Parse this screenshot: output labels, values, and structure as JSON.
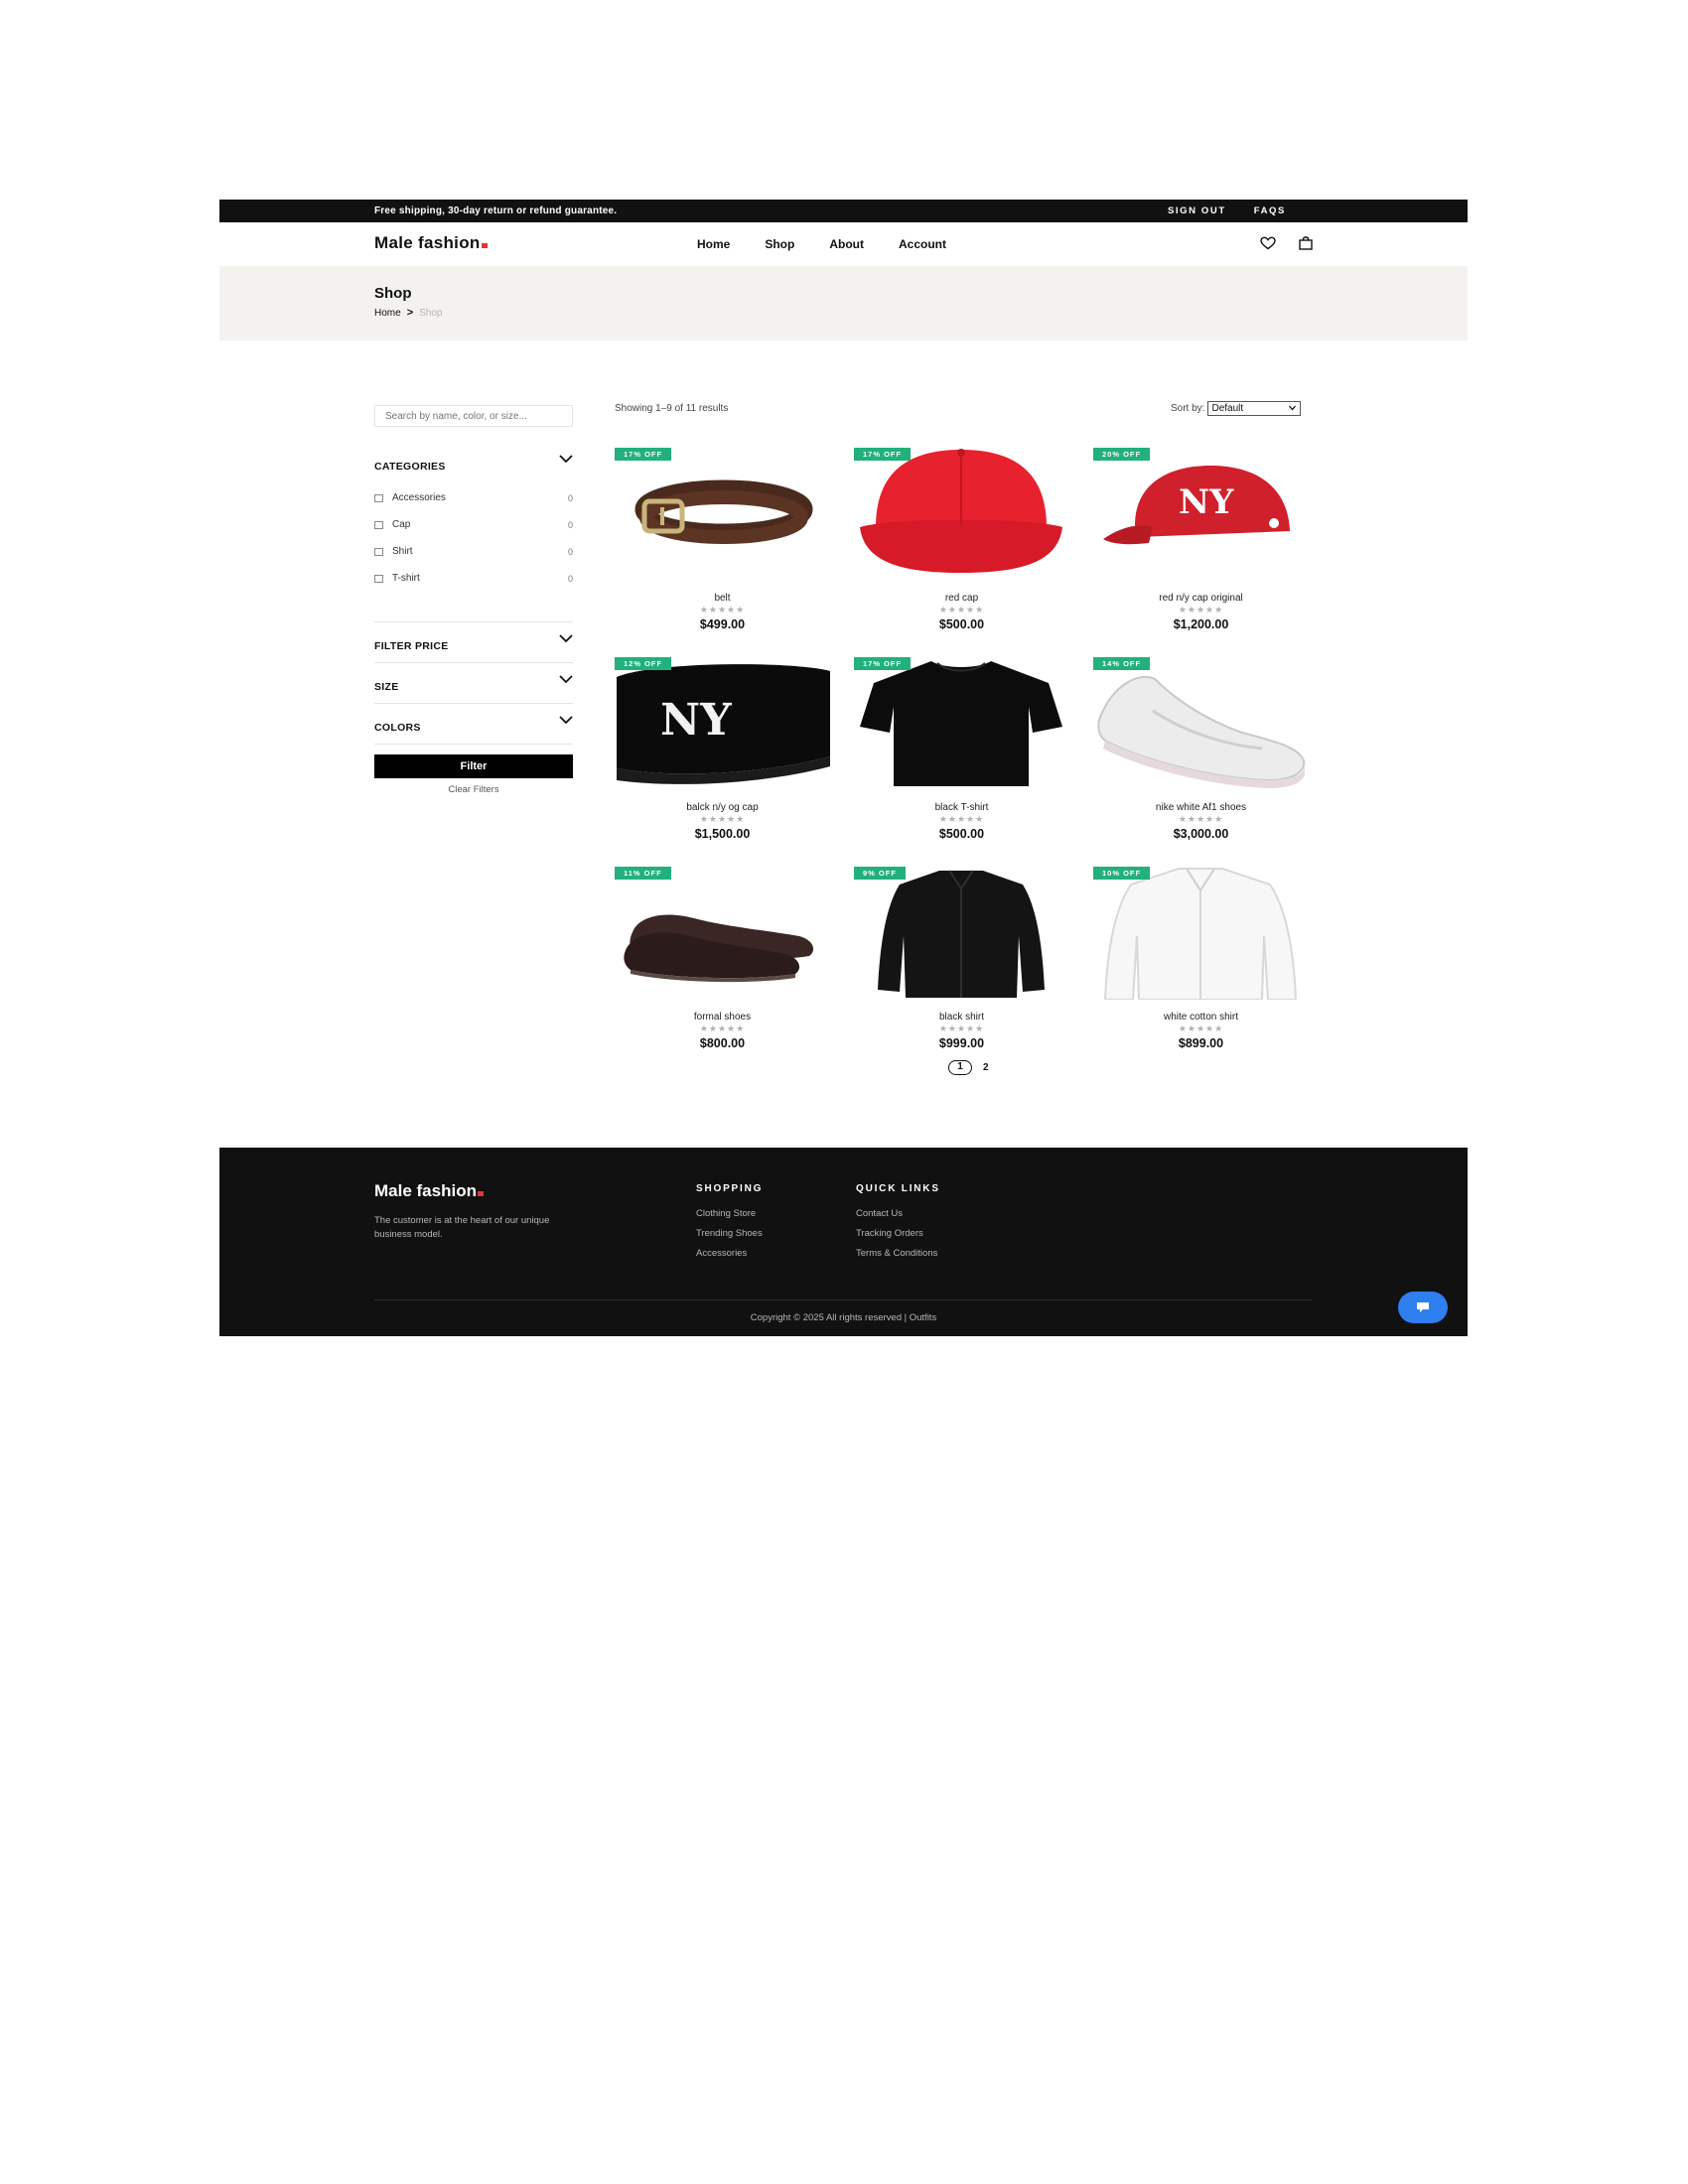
{
  "topbar": {
    "shipping": "Free shipping, 30-day return or refund guarantee.",
    "sign_out": "SIGN OUT",
    "faqs": "FAQS"
  },
  "header": {
    "logo": "Male fashion",
    "nav": [
      "Home",
      "Shop",
      "About",
      "Account"
    ],
    "icons": [
      "heart-icon",
      "bag-icon"
    ]
  },
  "breadcrumb": {
    "title": "Shop",
    "home": "Home",
    "current": "Shop"
  },
  "sidebar": {
    "search_placeholder": "Search by name, color, or size...",
    "categories_title": "CATEGORIES",
    "categories": [
      {
        "label": "Accessories",
        "count": "0"
      },
      {
        "label": "Cap",
        "count": "0"
      },
      {
        "label": "Shirt",
        "count": "0"
      },
      {
        "label": "T-shirt",
        "count": "0"
      }
    ],
    "filter_price": "FILTER PRICE",
    "size": "SIZE",
    "colors": "COLORS",
    "filter_button": "Filter",
    "clear_filters": "Clear Filters"
  },
  "results": {
    "showing": "Showing 1–9 of 11 results",
    "sort_label": "Sort by:",
    "sort_value": "Default"
  },
  "products": [
    {
      "name": "belt",
      "price": "$499.00",
      "badge": "17% OFF",
      "image": "belt"
    },
    {
      "name": "red cap",
      "price": "$500.00",
      "badge": "17% OFF",
      "image": "red-cap"
    },
    {
      "name": "red n/y cap original",
      "price": "$1,200.00",
      "badge": "20% OFF",
      "image": "red-ny-cap"
    },
    {
      "name": "balck n/y og cap",
      "price": "$1,500.00",
      "badge": "12% OFF",
      "image": "black-ny-cap"
    },
    {
      "name": "black T-shirt",
      "price": "$500.00",
      "badge": "17% OFF",
      "image": "black-tshirt"
    },
    {
      "name": "nike white Af1 shoes",
      "price": "$3,000.00",
      "badge": "14% OFF",
      "image": "white-shoes"
    },
    {
      "name": "formal shoes",
      "price": "$800.00",
      "badge": "11% OFF",
      "image": "formal-shoes"
    },
    {
      "name": "black shirt",
      "price": "$999.00",
      "badge": "9% OFF",
      "image": "black-shirt"
    },
    {
      "name": "white cotton shirt",
      "price": "$899.00",
      "badge": "10% OFF",
      "image": "white-shirt"
    }
  ],
  "rating_stars": "★★★★★",
  "pagination": {
    "pages": [
      "1",
      "2"
    ],
    "current": "1"
  },
  "footer": {
    "logo": "Male fashion",
    "description": "The customer is at the heart of our unique business model.",
    "shopping_title": "SHOPPING",
    "shopping_links": [
      "Clothing Store",
      "Trending Shoes",
      "Accessories"
    ],
    "quick_title": "QUICK LINKS",
    "quick_links": [
      "Contact Us",
      "Tracking Orders",
      "Terms & Conditions"
    ],
    "copyright": "Copyright © 2025 All rights reserved | Outfits"
  },
  "colors": {
    "badge": "#22b07d",
    "logo_dot": "#e53637",
    "topbar": "#111111",
    "band": "#f3f2ee",
    "chat": "#2e7ff0"
  }
}
